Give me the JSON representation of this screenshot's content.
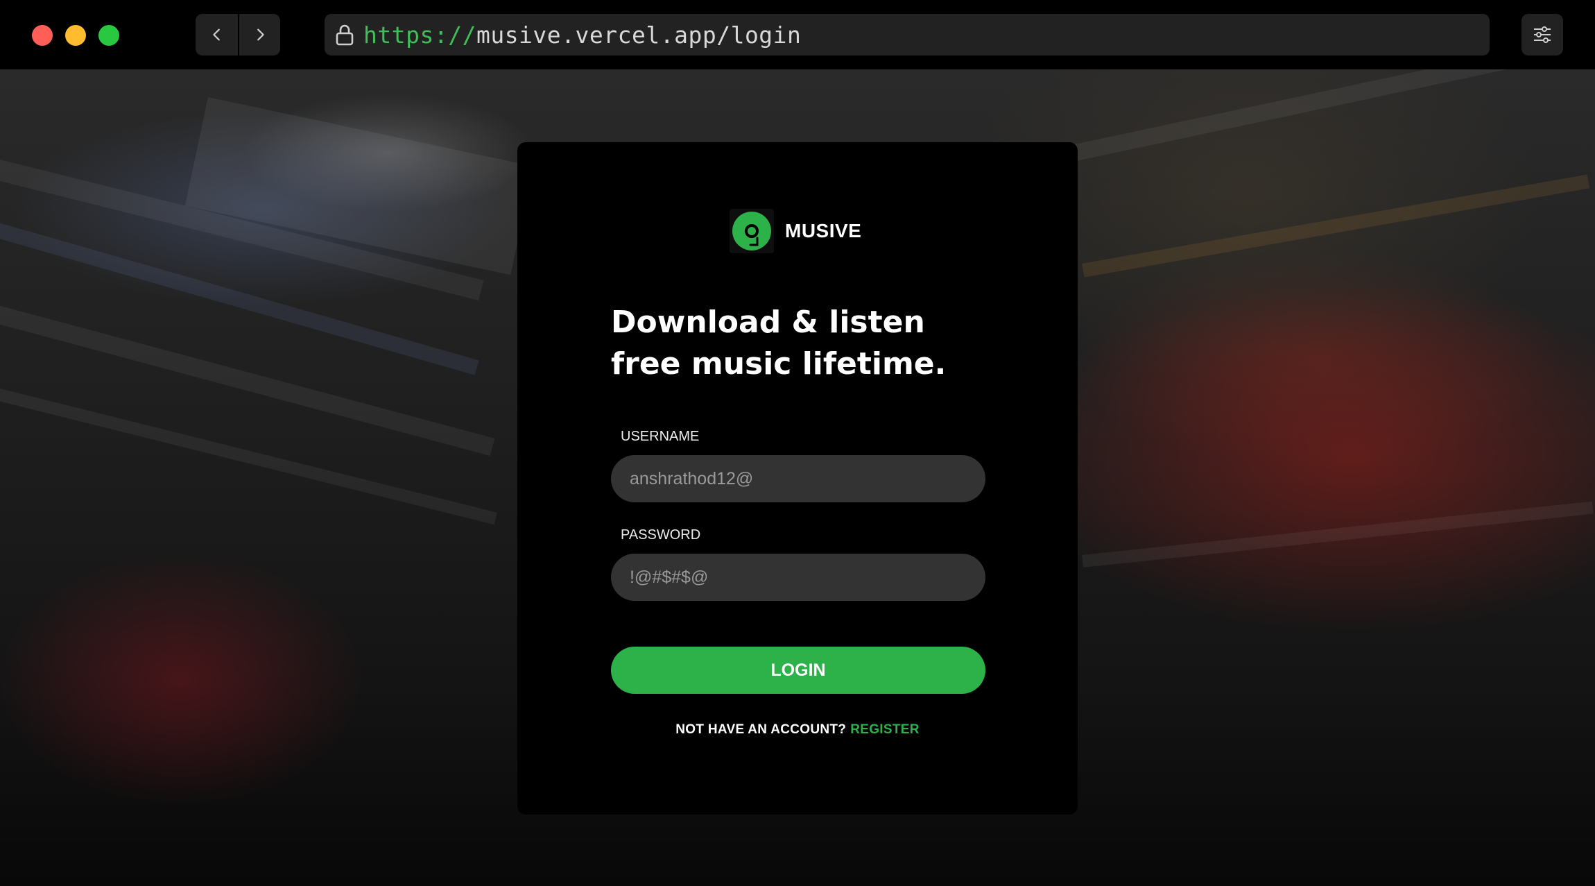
{
  "browser": {
    "url_scheme": "https://",
    "url_rest": "musive.vercel.app/login"
  },
  "brand": {
    "name": "MUSIVE",
    "accent_color": "#2db24a"
  },
  "login": {
    "headline": "Download & listen free music lifetime.",
    "username_label": "USERNAME",
    "username_value": "anshrathod12@",
    "password_label": "PASSWORD",
    "password_value": "!@#$#$@",
    "button_label": "LOGIN",
    "register_prompt": "NOT HAVE AN ACCOUNT?",
    "register_link": "REGISTER"
  },
  "icons": {
    "back": "chevron-left-icon",
    "forward": "chevron-right-icon",
    "lock": "lock-icon",
    "settings": "sliders-icon",
    "logo": "vinyl-record-icon"
  }
}
